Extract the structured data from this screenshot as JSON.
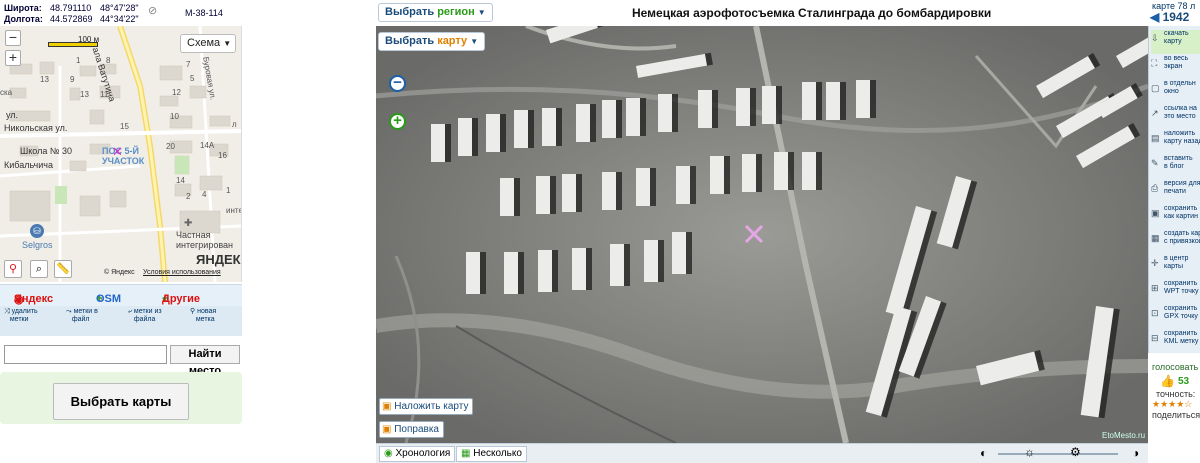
{
  "coords": {
    "lat_label": "Широта:",
    "lat_decimal": "48.791110",
    "lat_dms": "48°47'28\"",
    "lon_label": "Долгота:",
    "lon_decimal": "44.572869",
    "lon_dms": "44°34'22\"",
    "sheet": "M-38-114"
  },
  "minimap": {
    "zoom_in": "+",
    "zoom_out": "−",
    "scale": "100 м",
    "map_type": "Схема",
    "labels": {
      "street1": "ала Ватутина",
      "street2": "Буровая ул.",
      "street3": "Никольская ул.",
      "street4": "Кибальчича",
      "street5": "ул.",
      "school": "Школа № 30",
      "station": "ПОС 5-Й УЧАСТОК",
      "store": "Selgros",
      "clinic": "Частная интегрирован",
      "copyright": "© Яндекс",
      "terms": "Условия использования",
      "brand": "ЯНДЕКС",
      "n13": "13",
      "n9": "9",
      "n14a": "14А",
      "n14": "14",
      "n16": "16",
      "n8": "8",
      "n1": "1",
      "n7": "7",
      "n13b": "13",
      "n11": "11",
      "n5": "5",
      "n12": "12",
      "n10": "10",
      "n20": "20",
      "n15": "15",
      "n2": "2",
      "n4": "4",
      "n1b": "1",
      "inte": "инте",
      "l": "л",
      "ska": "ска"
    }
  },
  "layers": {
    "yandex": "Яндекс",
    "osm": "OSM",
    "other": "Другие"
  },
  "actions": [
    {
      "line1": "удалить",
      "line2": "метки"
    },
    {
      "line1": "метки в",
      "line2": "файл"
    },
    {
      "line1": "метки из",
      "line2": "файла"
    },
    {
      "line1": "новая",
      "line2": "метка"
    }
  ],
  "search": {
    "placeholder": "",
    "button": "Найти место"
  },
  "choose_maps": "Выбрать карты",
  "toolbar": {
    "region_prefix": "Выбрать ",
    "region_word": "регион",
    "map_prefix": "Выбрать ",
    "map_word": "карту",
    "title": "Немецкая аэрофотосъемка Сталинграда до бомбардировки"
  },
  "overlay": {
    "overlay_map": "Наложить карту",
    "correction": "Поправка",
    "watermark": "EtoMesto.ru"
  },
  "bottom": {
    "chronology": "Хронология",
    "multiple": "Несколько"
  },
  "right": {
    "header_line1": "карте 78 л",
    "year": "1942",
    "tools": [
      {
        "icon": "download-icon",
        "glyph": "⇩",
        "line1": "скачать",
        "line2": "карту"
      },
      {
        "icon": "fullscreen-icon",
        "glyph": "⛶",
        "line1": "во весь",
        "line2": "экран"
      },
      {
        "icon": "window-icon",
        "glyph": "▢",
        "line1": "в отдельн",
        "line2": "окно"
      },
      {
        "icon": "link-icon",
        "glyph": "↗",
        "line1": "ссылка на",
        "line2": "это место"
      },
      {
        "icon": "print-map-icon",
        "glyph": "▤",
        "line1": "наложить",
        "line2": "карту назад"
      },
      {
        "icon": "blog-icon",
        "glyph": "✎",
        "line1": "вставить",
        "line2": "в блог"
      },
      {
        "icon": "print-icon",
        "glyph": "⎙",
        "line1": "версия для",
        "line2": "печати"
      },
      {
        "icon": "save-image-icon",
        "glyph": "▣",
        "line1": "сохранить",
        "line2": "как картин"
      },
      {
        "icon": "grid-icon",
        "glyph": "▦",
        "line1": "создать карту",
        "line2": "с привязкой"
      },
      {
        "icon": "center-icon",
        "glyph": "✛",
        "line1": "в центр",
        "line2": "карты"
      },
      {
        "icon": "wpt-icon",
        "glyph": "⊞",
        "line1": "сохранить",
        "line2": "WPT точку"
      },
      {
        "icon": "gpx-icon",
        "glyph": "⊡",
        "line1": "сохранить",
        "line2": "GPX точку"
      },
      {
        "icon": "kml-icon",
        "glyph": "⊟",
        "line1": "сохранить",
        "line2": "KML метку"
      }
    ],
    "vote_label": "голосовать",
    "votes": "53",
    "accuracy_label": "точность:",
    "stars": 4,
    "share": "поделиться"
  },
  "colors": {
    "accent_green": "#2a9a1a",
    "link_blue": "#1a4b7a",
    "yandex_red": "#d11",
    "osm_blue": "#2266cc",
    "other_red": "#d11"
  }
}
